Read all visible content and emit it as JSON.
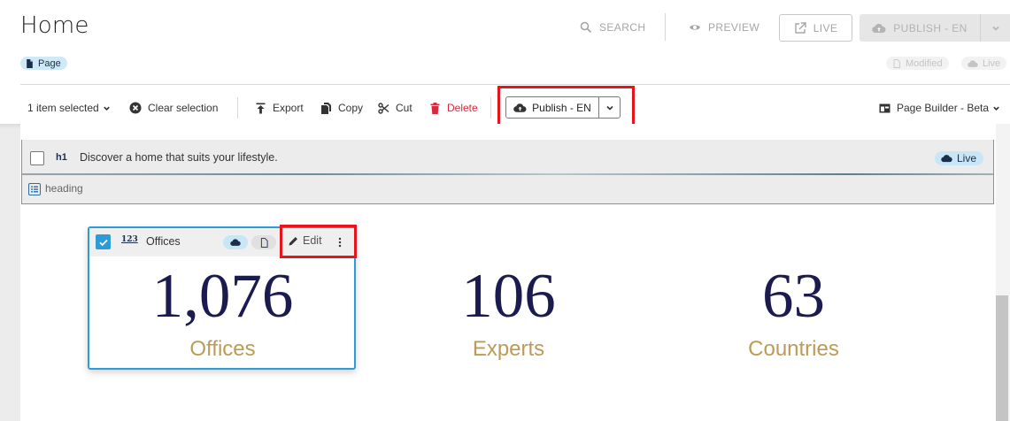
{
  "header": {
    "title": "Home",
    "type_chip": "Page",
    "search_label": "SEARCH",
    "preview_label": "PREVIEW",
    "live_label": "LIVE",
    "publish_label": "PUBLISH - EN",
    "status_modified": "Modified",
    "status_live": "Live"
  },
  "toolbar": {
    "selected_label": "1 item selected",
    "clear_label": "Clear selection",
    "export_label": "Export",
    "copy_label": "Copy",
    "cut_label": "Cut",
    "delete_label": "Delete",
    "publish_label": "Publish - EN",
    "builder_label": "Page Builder - Beta"
  },
  "heading_block": {
    "tag": "h1",
    "text": "Discover a home that suits your lifestyle.",
    "status": "Live",
    "type_label": "heading"
  },
  "stat_card": {
    "icon_text": "123",
    "name": "Offices",
    "edit_label": "Edit"
  },
  "stats": [
    {
      "number": "1,076",
      "label": "Offices"
    },
    {
      "number": "106",
      "label": "Experts"
    },
    {
      "number": "63",
      "label": "Countries"
    }
  ],
  "colors": {
    "accent_blue": "#2d9bd6",
    "highlight_red": "#e8141b",
    "delete_red": "#d62b3c",
    "stat_number": "#1c1b4f",
    "stat_label": "#bc9b57",
    "live_pill": "#c8e6f5"
  }
}
